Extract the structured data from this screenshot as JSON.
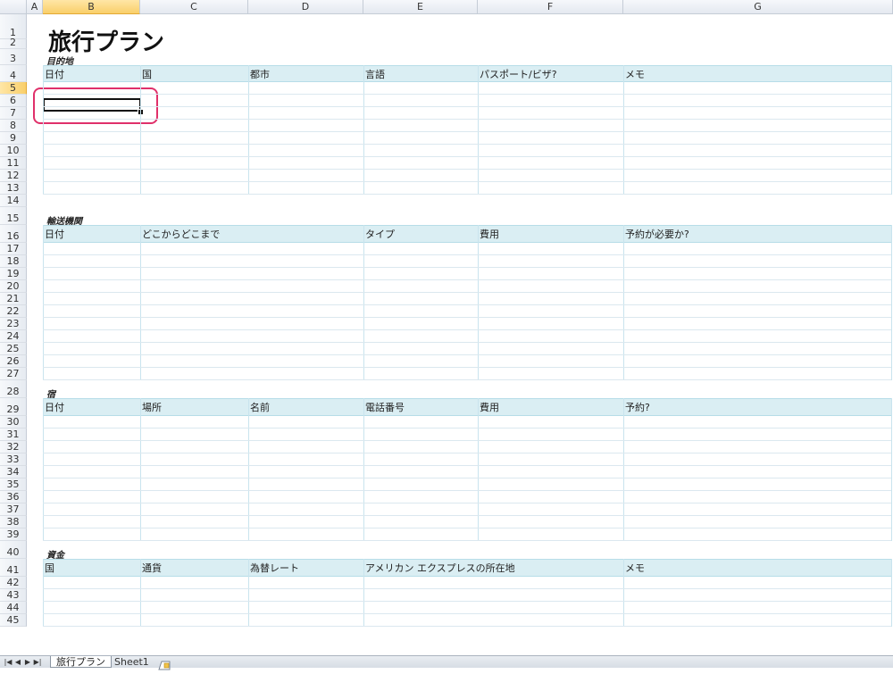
{
  "columns": [
    "A",
    "B",
    "C",
    "D",
    "E",
    "F",
    "G"
  ],
  "selected_column": "B",
  "selected_row": "5",
  "title": "旅行プラン",
  "sections": [
    {
      "label": "目的地",
      "headers": [
        "日付",
        "国",
        "都市",
        "言語",
        "パスポート/ビザ?",
        "メモ"
      ]
    },
    {
      "label": "輸送機関",
      "headers": [
        "日付",
        "どこからどこまで",
        "タイプ",
        "費用",
        "予約が必要か?"
      ]
    },
    {
      "label": "宿",
      "headers": [
        "日付",
        "場所",
        "名前",
        "電話番号",
        "費用",
        "予約?"
      ]
    },
    {
      "label": "資金",
      "headers": [
        "国",
        "通貨",
        "為替レート",
        "アメリカン エクスプレスの所在地",
        "メモ"
      ]
    }
  ],
  "sheet_tabs": [
    {
      "label": "旅行プラン",
      "active": true
    },
    {
      "label": "Sheet1",
      "active": false
    }
  ],
  "nav_buttons": [
    "|◀",
    "◀",
    "▶",
    "▶|"
  ]
}
